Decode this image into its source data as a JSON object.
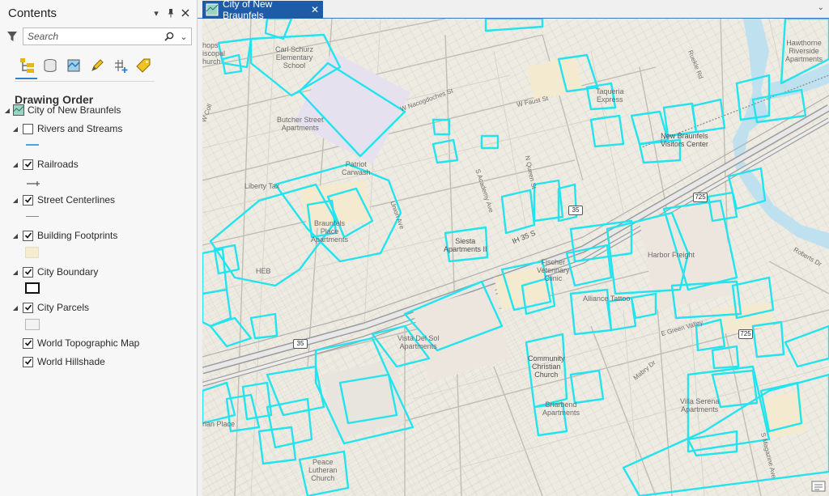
{
  "contents": {
    "title": "Contents",
    "search_placeholder": "Search",
    "section_title": "Drawing Order",
    "map_name": "City of New Braunfels",
    "layers": [
      {
        "label": "Rivers and Streams",
        "checked": false
      },
      {
        "label": "Railroads",
        "checked": true
      },
      {
        "label": "Street Centerlines",
        "checked": true
      },
      {
        "label": "Building Footprints",
        "checked": true
      },
      {
        "label": "City Boundary",
        "checked": true
      },
      {
        "label": "City Parcels",
        "checked": true
      },
      {
        "label": "World Topographic Map",
        "checked": true
      },
      {
        "label": "World Hillshade",
        "checked": true
      }
    ]
  },
  "map_tab": {
    "title": "City of New Braunfels"
  },
  "map_labels": {
    "carl_schurz": "Carl Schurz\nElementary\nSchool",
    "bishops": "hops\niscopal\nhurch",
    "butcher": "Butcher Street\nApartments",
    "taqueria": "Taqueria\nExpress",
    "hawthorne": "Hawthorne\nRiverside\nApartments",
    "visitors": "New Braunfels\nVisitors Center",
    "patriot": "Patriot\nCarwash",
    "liberty": "Liberty Tax",
    "braunfels_place": "Braunfels\nPlace\nApartments",
    "heb": "HEB",
    "siesta": "Siesta\nApartments II",
    "fischer": "Fischer\nVeterinary\nClinic",
    "harbor": "Harbor Freight",
    "alliance": "Alliance Tattoo",
    "vista": "Vista Del Sol\nApartments",
    "community": "Community\nChristian\nChurch",
    "briarbend": "Briarbend\nApartments",
    "villa": "Villa Serena\nApartments",
    "peace": "Peace\nLutheran\nChurch",
    "rian_place": "rian Place",
    "ih35": "IH 35 S",
    "s35a": "35",
    "s35b": "35",
    "s725a": "725",
    "s725b": "725",
    "w_nacogdoches": "W Nacogdoches St",
    "w_faust": "W Faust St",
    "ruekle": "Ruekle Rd",
    "academy": "S Academy Ave",
    "queen": "N Queen St",
    "union": "Union Ave",
    "w_coll": "W Coll",
    "e_green_valley": "E Green Valley",
    "mabry": "Mabry Dr",
    "roberts": "Roberts Dr",
    "magazine": "S Magazine Ave"
  }
}
